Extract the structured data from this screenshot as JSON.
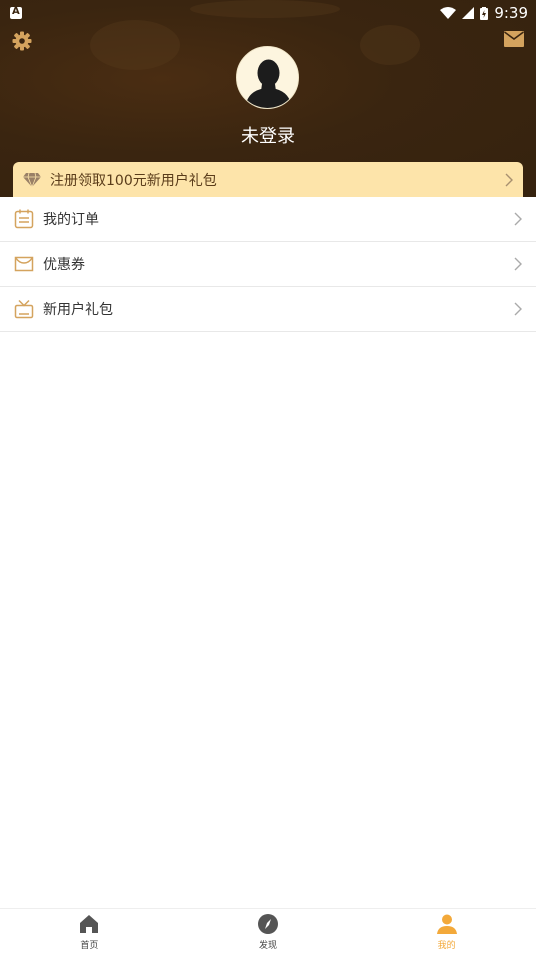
{
  "status_bar": {
    "time": "9:39"
  },
  "colors": {
    "header_bg": "#3a2510",
    "accent": "#f3a93a",
    "icon_gold": "#d4a35e",
    "promo_bg": "#fde4aa"
  },
  "header": {
    "settings_icon": "gear-icon",
    "mail_icon": "mail-icon",
    "avatar_icon": "user-silhouette",
    "login_text": "未登录"
  },
  "promo": {
    "icon": "diamond-icon",
    "text": "注册领取100元新用户礼包"
  },
  "menu": {
    "items": [
      {
        "icon": "order-list-icon",
        "label": "我的订单"
      },
      {
        "icon": "coupon-icon",
        "label": "优惠券"
      },
      {
        "icon": "gift-box-icon",
        "label": "新用户礼包"
      }
    ]
  },
  "tabbar": {
    "tabs": [
      {
        "icon": "home-icon",
        "label": "首页",
        "active": false
      },
      {
        "icon": "compass-icon",
        "label": "发现",
        "active": false
      },
      {
        "icon": "person-icon",
        "label": "我的",
        "active": true
      }
    ]
  }
}
